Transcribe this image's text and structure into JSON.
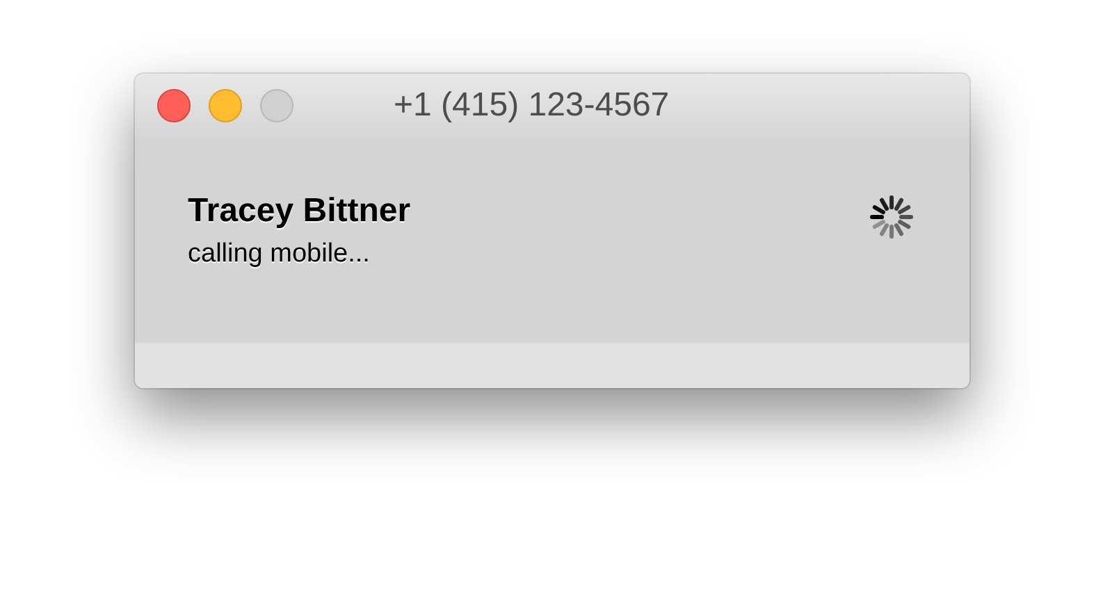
{
  "window": {
    "title": "+1 (415) 123-4567",
    "controls": [
      {
        "kind": "close",
        "disabled": false
      },
      {
        "kind": "minimize",
        "disabled": false
      },
      {
        "kind": "zoom",
        "disabled": true
      }
    ]
  },
  "call": {
    "name": "Tracey Bittner",
    "status": "calling mobile..."
  }
}
